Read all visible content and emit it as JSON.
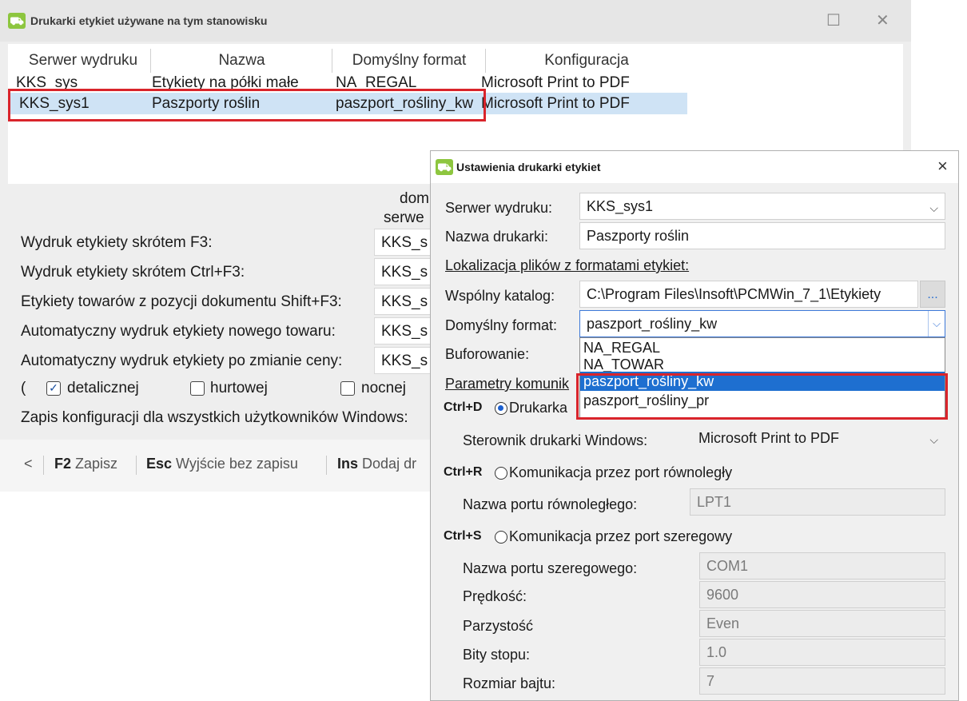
{
  "main": {
    "title": "Drukarki etykiet używane na tym stanowisku",
    "grid": {
      "headers": [
        "Serwer wydruku",
        "Nazwa",
        "Domyślny format",
        "Konfiguracja"
      ],
      "rows": [
        [
          "KKS_sys",
          "Etykiety na półki małe",
          "NA_REGAL",
          "Microsoft Print to PDF"
        ],
        [
          "KKS_sys1",
          "Paszporty roślin",
          "paszport_rośliny_kw",
          "Microsoft Print to PDF"
        ]
      ]
    },
    "col_header_top": "dom",
    "col_header_bottom": "serwe",
    "settings": [
      {
        "label": "Wydruk etykiety skrótem F3:",
        "value": "KKS_s"
      },
      {
        "label": "Wydruk etykiety skrótem Ctrl+F3:",
        "value": "KKS_s"
      },
      {
        "label": "Etykiety towarów z pozycji dokumentu Shift+F3:",
        "value": "KKS_s"
      },
      {
        "label": "Automatyczny wydruk etykiety nowego towaru:",
        "value": "KKS_s"
      },
      {
        "label": "Automatyczny wydruk etykiety po zmianie ceny:",
        "value": "KKS_s"
      }
    ],
    "price_paren": "(",
    "price_types": [
      {
        "label": "detalicznej",
        "checked": true
      },
      {
        "label": "hurtowej",
        "checked": false
      },
      {
        "label": "nocnej",
        "checked": false
      }
    ],
    "save_all_label": "Zapis konfiguracji dla wszystkich użytkowników Windows:",
    "footer": {
      "back": "<",
      "keys": [
        {
          "key": "F2",
          "label": "Zapisz"
        },
        {
          "key": "Esc",
          "label": "Wyjście bez zapisu"
        },
        {
          "key": "Ins",
          "label": "Dodaj dr"
        }
      ]
    }
  },
  "dialog": {
    "title": "Ustawienia drukarki etykiet",
    "close": "×",
    "server_label": "Serwer wydruku:",
    "server_value": "KKS_sys1",
    "printer_name_label": "Nazwa drukarki:",
    "printer_name_value": "Paszporty roślin",
    "location_heading": "Lokalizacja plików z formatami etykiet:",
    "common_dir_label": "Wspólny katalog:",
    "common_dir_value": "C:\\Program Files\\Insoft\\PCMWin_7_1\\Etykiety",
    "browse": "...",
    "default_format_label": "Domyślny format:",
    "default_format_value": "paszport_rośliny_kw",
    "buffering_label": "Buforowanie:",
    "comm_heading": "Parametry komunik",
    "format_options": [
      "NA_REGAL",
      "NA_TOWAR",
      "paszport_rośliny_kw",
      "paszport_rośliny_pr"
    ],
    "selected_option": "paszport_rośliny_kw",
    "ctrl_d": "Ctrl+D",
    "printer_radio_label": "Drukarka",
    "driver_label": "Sterownik drukarki Windows:",
    "driver_value": "Microsoft Print to PDF",
    "ctrl_r": "Ctrl+R",
    "parallel_label": "Komunikacja przez port równoległy",
    "parallel_port_label": "Nazwa portu równoległego:",
    "parallel_port_value": "LPT1",
    "ctrl_s": "Ctrl+S",
    "serial_label": "Komunikacja przez port szeregowy",
    "serial_port_label": "Nazwa portu szeregowego:",
    "serial_port_value": "COM1",
    "speed_label": "Prędkość:",
    "speed_value": "9600",
    "parity_label": "Parzystość",
    "parity_value": "Even",
    "stop_bits_label": "Bity stopu:",
    "stop_bits_value": "1.0",
    "byte_size_label": "Rozmiar bajtu:",
    "byte_size_value": "7"
  },
  "colors": {
    "highlight_row": "#cfe3f5",
    "selected_option": "#1e6fd0",
    "annotation": "#d9242b",
    "brand": "#8dc63f"
  }
}
